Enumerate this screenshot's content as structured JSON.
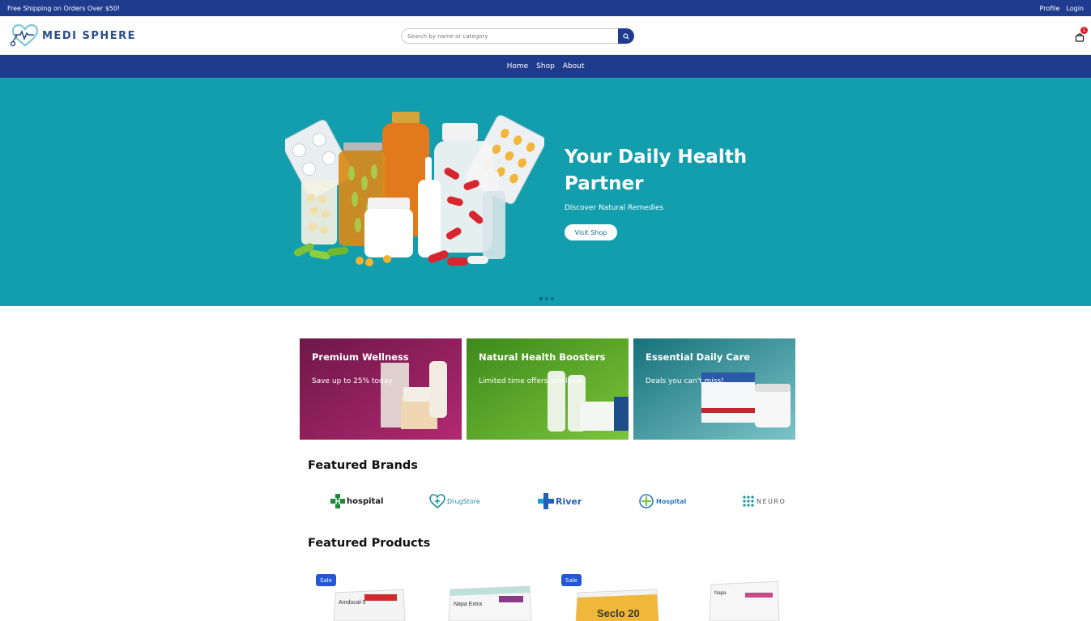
{
  "topbar": {
    "promo": "Free Shipping on Orders Over $50!",
    "profile": "Profile",
    "login": "Login"
  },
  "header": {
    "logo_text": "MEDI SPHERE",
    "search_placeholder": "Search by name or category",
    "search_value": "",
    "cart_count": "1"
  },
  "nav": {
    "items": [
      "Home",
      "Shop",
      "About"
    ]
  },
  "hero": {
    "title": "Your Daily Health Partner",
    "subtitle": "Discover Natural Remedies",
    "button": "Visit Shop",
    "slides": 3,
    "active_slide": 1
  },
  "promos": [
    {
      "title": "Premium Wellness",
      "subtitle": "Save up to 25% today",
      "color": "#8e1f5a"
    },
    {
      "title": "Natural Health Boosters",
      "subtitle": "Limited time offers available",
      "color": "#5a9c22"
    },
    {
      "title": "Essential Daily Care",
      "subtitle": "Deals you can't miss!",
      "color": "#1f8a92"
    }
  ],
  "brands_section": {
    "title": "Featured Brands",
    "brands": [
      {
        "name": "hospital",
        "icon": "hospital-cross-icon",
        "color": "#1c8a3a"
      },
      {
        "name": "DrugStore",
        "icon": "drugstore-heart-icon",
        "color": "#1a8fa0"
      },
      {
        "name": "River",
        "icon": "river-cross-icon",
        "color": "#2460b6"
      },
      {
        "name": "Hospital",
        "icon": "hospital-circle-icon",
        "color": "#2b7bbf"
      },
      {
        "name": "NEURO",
        "icon": "neuro-grid-icon",
        "color": "#555555"
      }
    ]
  },
  "products_section": {
    "title": "Featured Products",
    "sale_label": "Sale",
    "products": [
      {
        "name": "Amdocal-5",
        "sale": true
      },
      {
        "name": "Napa Extra",
        "sale": false
      },
      {
        "name": "Seclo 20",
        "sale": true
      },
      {
        "name": "Napa",
        "sale": false
      }
    ]
  },
  "colors": {
    "primary": "#1f3b8e",
    "hero": "#139eae",
    "sale": "#2457d6",
    "badge": "#e01b24"
  }
}
